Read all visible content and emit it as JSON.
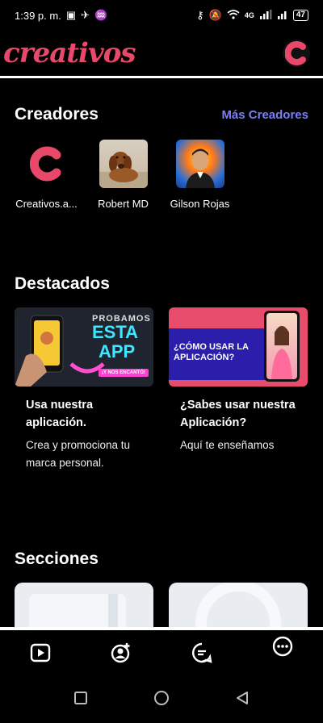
{
  "status": {
    "time": "1:39 p. m.",
    "network": "4G",
    "battery": "47"
  },
  "app": {
    "brand": "creativos",
    "logo_letter": "C",
    "accent": "#e8496a"
  },
  "creators": {
    "title": "Creadores",
    "more_label": "Más Creadores",
    "items": [
      {
        "name": "Creativos.a...",
        "icon": "creativos-logo-icon"
      },
      {
        "name": "Robert MD",
        "icon": "dog-photo"
      },
      {
        "name": "Gilson Rojas",
        "icon": "man-photo"
      }
    ]
  },
  "featured": {
    "title": "Destacados",
    "cards": [
      {
        "banner_top": "PROBAMOS",
        "banner_mid": "ESTA",
        "banner_bot": "APP",
        "banner_tag": "¡Y NOS ENCANTÓ!",
        "title": "Usa nuestra aplicación.",
        "desc": "Crea y promociona tu marca personal."
      },
      {
        "banner_line1": "¿CÓMO USAR LA",
        "banner_line2": "APLICACIÓN?",
        "title": "¿Sabes usar nuestra Aplicación?",
        "desc": "Aquí te enseñamos"
      }
    ]
  },
  "sections": {
    "title": "Secciones"
  },
  "bottom_nav": [
    {
      "icon": "play-icon"
    },
    {
      "icon": "add-user-icon"
    },
    {
      "icon": "chat-icon"
    },
    {
      "icon": "more-icon"
    }
  ]
}
